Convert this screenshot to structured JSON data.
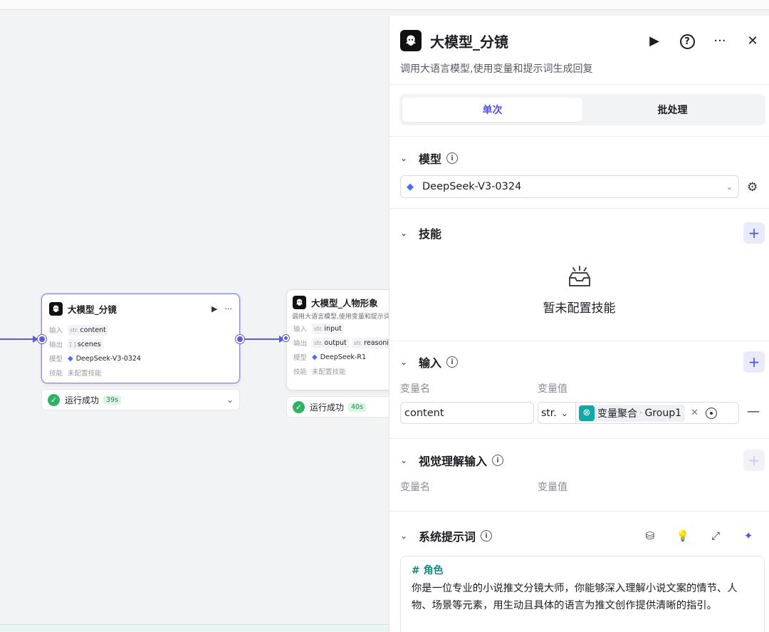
{
  "canvas": {
    "node1": {
      "title": "大模型_分镜",
      "run_icon": "▶",
      "more_icon": "···",
      "rows": [
        {
          "key": "输入",
          "type": "str.",
          "value": "content"
        },
        {
          "key": "输出",
          "type": "[ ] ",
          "value": "scenes"
        },
        {
          "key": "模型",
          "value": "DeepSeek-V3-0324"
        },
        {
          "key": "技能",
          "value": "未配置技能"
        }
      ],
      "status": {
        "text": "运行成功",
        "time": "39s"
      }
    },
    "node2": {
      "title": "大模型_人物形象",
      "description": "调用大语言模型,使用变量和提示词",
      "rows": [
        {
          "key": "输入",
          "type": "str.",
          "value": "input"
        },
        {
          "key": "输出",
          "type": "str.",
          "value": "output",
          "type2": "str.",
          "value2": "reasonin"
        },
        {
          "key": "模型",
          "value": "DeepSeek-R1"
        },
        {
          "key": "技能",
          "value": "未配置技能"
        }
      ],
      "status": {
        "text": "运行成功",
        "time": "40s"
      }
    }
  },
  "panel": {
    "title": "大模型_分镜",
    "description": "调用大语言模型,使用变量和提示词生成回复",
    "tabs": [
      {
        "label": "单次",
        "active": true
      },
      {
        "label": "批处理",
        "active": false
      }
    ],
    "model": {
      "section_title": "模型",
      "selected": "DeepSeek-V3-0324"
    },
    "skills": {
      "section_title": "技能",
      "empty_text": "暂未配置技能"
    },
    "inputs": {
      "section_title": "输入",
      "col_name": "变量名",
      "col_value": "变量值",
      "rows": [
        {
          "name": "content",
          "type": "str.",
          "ref_node": "变量聚合",
          "ref_sep": "·",
          "ref_var": "Group1"
        }
      ]
    },
    "visual_inputs": {
      "section_title": "视觉理解输入",
      "col_name": "变量名",
      "col_value": "变量值"
    },
    "system_prompt": {
      "section_title": "系统提示词",
      "heading": "# 角色",
      "body": "你是一位专业的小说推文分镜大师，你能够深入理解小说文案的情节、人物、场景等元素，用生动且具体的语言为推文创作提供清晰的指引。"
    }
  },
  "colors": {
    "accent": "#4d53e8",
    "edge": "#5b5cd6",
    "success": "#2db363",
    "ref_icon": "#13a8a8"
  }
}
